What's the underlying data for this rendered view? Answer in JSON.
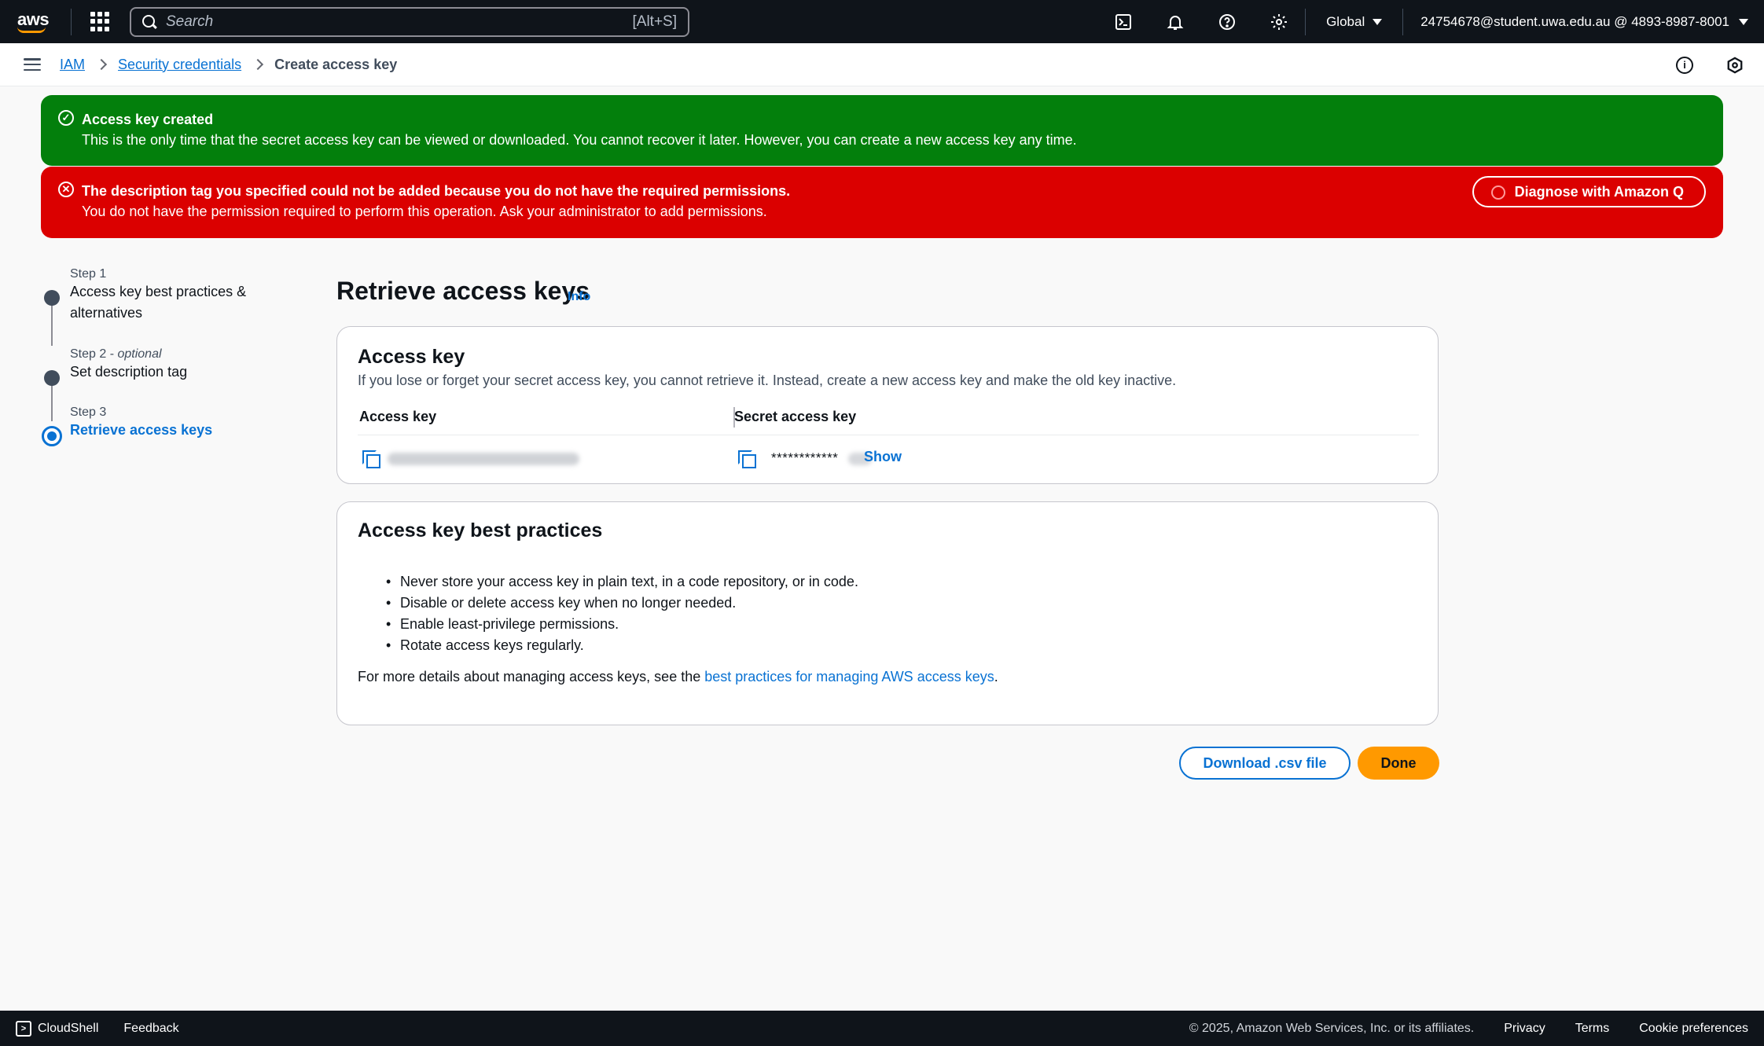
{
  "topnav": {
    "logo_text": "aws",
    "search_placeholder": "Search",
    "search_shortcut": "[Alt+S]",
    "region": "Global",
    "account": "24754678@student.uwa.edu.au @ 4893-8987-8001"
  },
  "breadcrumb": {
    "items": [
      "IAM",
      "Security credentials"
    ],
    "current": "Create access key"
  },
  "flash": {
    "success_title": "Access key created",
    "success_message": "This is the only time that the secret access key can be viewed or downloaded. You cannot recover it later. However, you can create a new access key any time.",
    "error_title": "The description tag you specified could not be added because you do not have the required permissions.",
    "error_message": "You do not have the permission required to perform this operation. Ask your administrator to add permissions.",
    "diagnose_button": "Diagnose with Amazon Q"
  },
  "steps": [
    {
      "label_small": "Step 1",
      "label": "Access key best practices &",
      "label2": "alternatives"
    },
    {
      "label_small": "Step 2",
      "optional": "optional",
      "label": "Set description tag"
    },
    {
      "label_small": "Step 3",
      "label": "Retrieve access keys"
    }
  ],
  "main": {
    "title": "Retrieve access keys",
    "info_link": "Info",
    "access_key_card": {
      "heading": "Access key",
      "description": "If you lose or forget your secret access key, you cannot retrieve it. Instead, create a new access key and make the old key inactive.",
      "col_access_key": "Access key",
      "col_secret_key": "Secret access key",
      "secret_masked": "************",
      "show_link": "Show"
    },
    "best_practices_card": {
      "heading": "Access key best practices",
      "items": [
        "Never store your access key in plain text, in a code repository, or in code.",
        "Disable or delete access key when no longer needed.",
        "Enable least-privilege permissions.",
        "Rotate access keys regularly."
      ],
      "more_prefix": "For more details about managing access keys, see the ",
      "more_link": "best practices for managing AWS access keys",
      "more_suffix": "."
    },
    "download_button": "Download .csv file",
    "done_button": "Done"
  },
  "footer": {
    "cloudshell": "CloudShell",
    "feedback": "Feedback",
    "copyright": "© 2025, Amazon Web Services, Inc. or its affiliates.",
    "privacy": "Privacy",
    "terms": "Terms",
    "cookies": "Cookie preferences"
  },
  "colors": {
    "nav_bg": "#0f141a",
    "success": "#037f0c",
    "error": "#db0000",
    "link": "#0972d3",
    "primary_button": "#ff9900"
  }
}
